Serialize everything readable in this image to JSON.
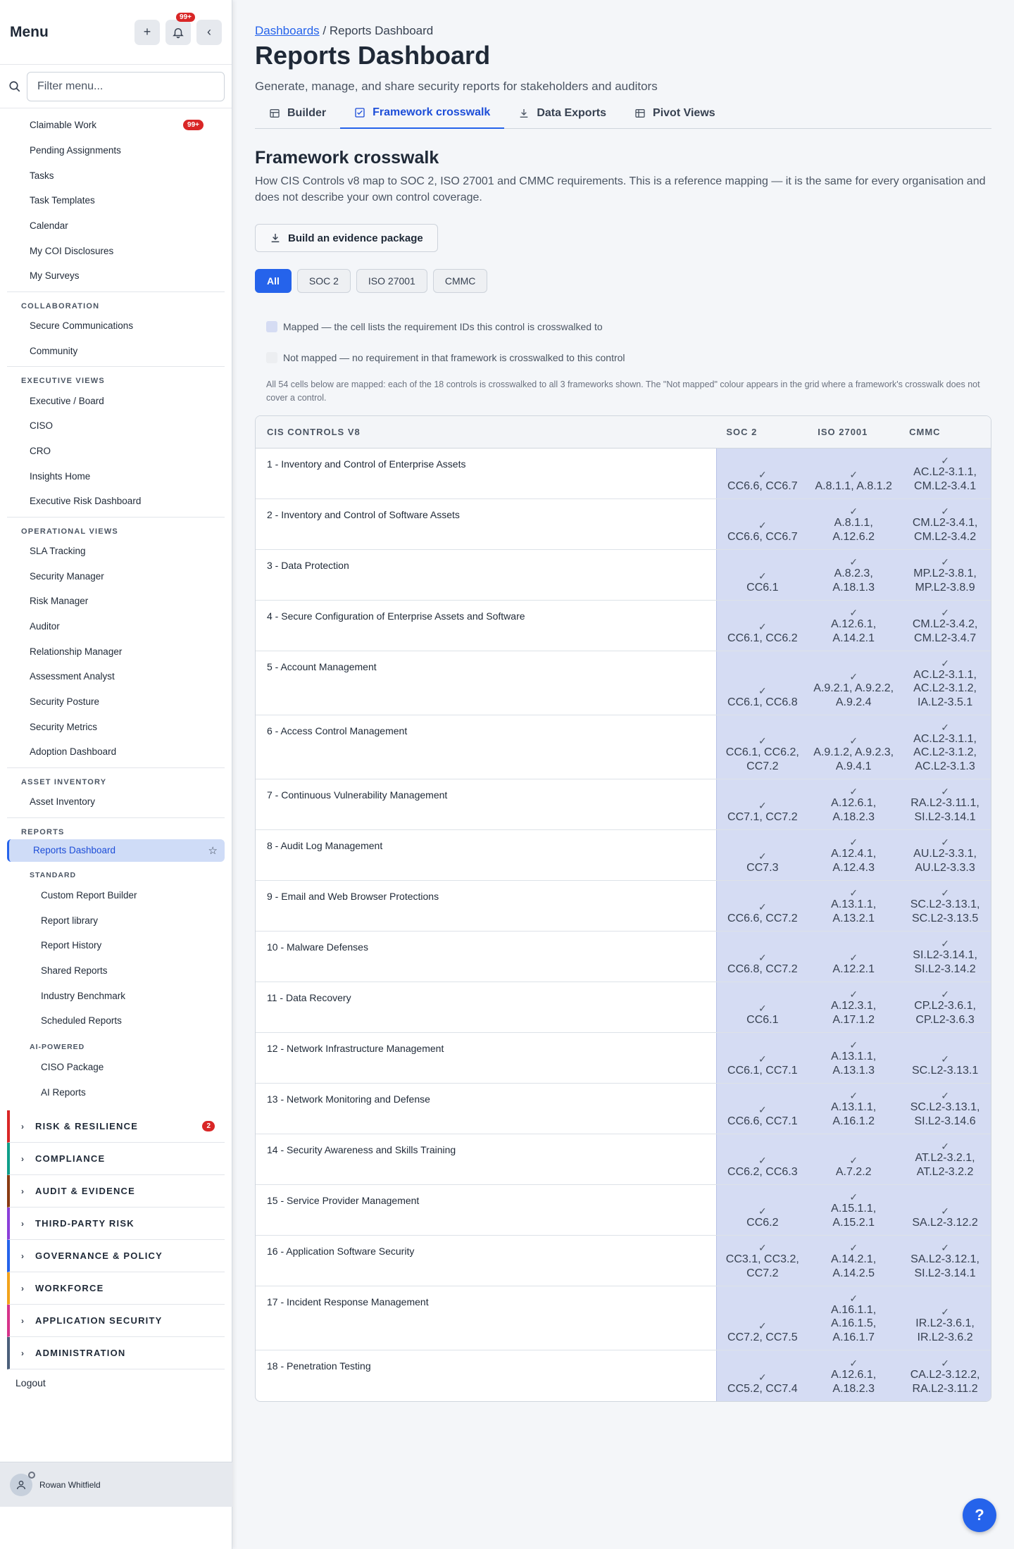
{
  "sidebar": {
    "title": "Menu",
    "notification_count": "99+",
    "filter_placeholder": "Filter menu...",
    "top_items": [
      {
        "label": "Claimable Work",
        "badge": "99+"
      },
      {
        "label": "Pending Assignments"
      },
      {
        "label": "Tasks"
      },
      {
        "label": "Task Templates"
      },
      {
        "label": "Calendar"
      },
      {
        "label": "My COI Disclosures"
      },
      {
        "label": "My Surveys"
      }
    ],
    "collaboration": {
      "heading": "COLLABORATION",
      "items": [
        "Secure Communications",
        "Community"
      ]
    },
    "executive": {
      "heading": "EXECUTIVE VIEWS",
      "items": [
        "Executive / Board",
        "CISO",
        "CRO",
        "Insights Home",
        "Executive Risk Dashboard"
      ]
    },
    "operational": {
      "heading": "OPERATIONAL VIEWS",
      "items": [
        "SLA Tracking",
        "Security Manager",
        "Risk Manager",
        "Auditor",
        "Relationship Manager",
        "Assessment Analyst",
        "Security Posture",
        "Security Metrics",
        "Adoption Dashboard"
      ]
    },
    "asset": {
      "heading": "ASSET INVENTORY",
      "items": [
        "Asset Inventory"
      ]
    },
    "reports": {
      "heading": "REPORTS",
      "active_item": "Reports Dashboard",
      "standard_heading": "STANDARD",
      "standard_items": [
        "Custom Report Builder",
        "Report library",
        "Report History",
        "Shared Reports",
        "Industry Benchmark",
        "Scheduled Reports"
      ],
      "ai_heading": "AI-POWERED",
      "ai_items": [
        "CISO Package",
        "AI Reports"
      ]
    },
    "categories": [
      {
        "label": "RISK & RESILIENCE",
        "color": "#d92626",
        "badge": "2"
      },
      {
        "label": "COMPLIANCE",
        "color": "#0f9f8a"
      },
      {
        "label": "AUDIT & EVIDENCE",
        "color": "#8a3b12"
      },
      {
        "label": "THIRD-PARTY RISK",
        "color": "#8b3fd9"
      },
      {
        "label": "GOVERNANCE & POLICY",
        "color": "#2563eb"
      },
      {
        "label": "WORKFORCE",
        "color": "#f2a31b"
      },
      {
        "label": "APPLICATION SECURITY",
        "color": "#d6338a"
      },
      {
        "label": "ADMINISTRATION",
        "color": "#4b5f7a"
      }
    ],
    "logout": "Logout",
    "user_name": "Rowan Whitfield"
  },
  "breadcrumb": {
    "parent": "Dashboards",
    "separator": " / ",
    "current": "Reports Dashboard"
  },
  "page": {
    "title": "Reports Dashboard",
    "subtitle": "Generate, manage, and share security reports for stakeholders and auditors"
  },
  "tabs": [
    {
      "label": "Builder",
      "icon": "table-icon"
    },
    {
      "label": "Framework crosswalk",
      "icon": "checklist-icon",
      "active": true
    },
    {
      "label": "Data Exports",
      "icon": "download-icon"
    },
    {
      "label": "Pivot Views",
      "icon": "grid-icon"
    }
  ],
  "crosswalk": {
    "title": "Framework crosswalk",
    "description": "How CIS Controls v8 map to SOC 2, ISO 27001 and CMMC requirements. This is a reference mapping — it is the same for every organisation and does not describe your own control coverage.",
    "evidence_button": "Build an evidence package",
    "filters": [
      "All",
      "SOC 2",
      "ISO 27001",
      "CMMC"
    ],
    "legend_mapped": "Mapped — the cell lists the requirement IDs this control is crosswalked to",
    "legend_not_mapped": "Not mapped — no requirement in that framework is crosswalked to this control",
    "mapped_color": "#d5dcf3",
    "not_mapped_color": "#eceef1",
    "note": "All 54 cells below are mapped: each of the 18 controls is crosswalked to all 3 frameworks shown. The \"Not mapped\" colour appears in the grid where a framework's crosswalk does not cover a control.",
    "columns": [
      "CIS CONTROLS V8",
      "SOC 2",
      "ISO 27001",
      "CMMC"
    ],
    "check": "✓",
    "rows": [
      {
        "control": "1 - Inventory and Control of Enterprise Assets",
        "soc2": "CC6.6, CC6.7",
        "iso": "A.8.1.1, A.8.1.2",
        "cmmc": "AC.L2-3.1.1, CM.L2-3.4.1"
      },
      {
        "control": "2 - Inventory and Control of Software Assets",
        "soc2": "CC6.6, CC6.7",
        "iso": "A.8.1.1, A.12.6.2",
        "cmmc": "CM.L2-3.4.1, CM.L2-3.4.2"
      },
      {
        "control": "3 - Data Protection",
        "soc2": "CC6.1",
        "iso": "A.8.2.3, A.18.1.3",
        "cmmc": "MP.L2-3.8.1, MP.L2-3.8.9"
      },
      {
        "control": "4 - Secure Configuration of Enterprise Assets and Software",
        "soc2": "CC6.1, CC6.2",
        "iso": "A.12.6.1, A.14.2.1",
        "cmmc": "CM.L2-3.4.2, CM.L2-3.4.7"
      },
      {
        "control": "5 - Account Management",
        "soc2": "CC6.1, CC6.8",
        "iso": "A.9.2.1, A.9.2.2, A.9.2.4",
        "cmmc": "AC.L2-3.1.1, AC.L2-3.1.2, IA.L2-3.5.1"
      },
      {
        "control": "6 - Access Control Management",
        "soc2": "CC6.1, CC6.2, CC7.2",
        "iso": "A.9.1.2, A.9.2.3, A.9.4.1",
        "cmmc": "AC.L2-3.1.1, AC.L2-3.1.2, AC.L2-3.1.3"
      },
      {
        "control": "7 - Continuous Vulnerability Management",
        "soc2": "CC7.1, CC7.2",
        "iso": "A.12.6.1, A.18.2.3",
        "cmmc": "RA.L2-3.11.1, SI.L2-3.14.1"
      },
      {
        "control": "8 - Audit Log Management",
        "soc2": "CC7.3",
        "iso": "A.12.4.1, A.12.4.3",
        "cmmc": "AU.L2-3.3.1, AU.L2-3.3.3"
      },
      {
        "control": "9 - Email and Web Browser Protections",
        "soc2": "CC6.6, CC7.2",
        "iso": "A.13.1.1, A.13.2.1",
        "cmmc": "SC.L2-3.13.1, SC.L2-3.13.5"
      },
      {
        "control": "10 - Malware Defenses",
        "soc2": "CC6.8, CC7.2",
        "iso": "A.12.2.1",
        "cmmc": "SI.L2-3.14.1, SI.L2-3.14.2"
      },
      {
        "control": "11 - Data Recovery",
        "soc2": "CC6.1",
        "iso": "A.12.3.1, A.17.1.2",
        "cmmc": "CP.L2-3.6.1, CP.L2-3.6.3"
      },
      {
        "control": "12 - Network Infrastructure Management",
        "soc2": "CC6.1, CC7.1",
        "iso": "A.13.1.1, A.13.1.3",
        "cmmc": "SC.L2-3.13.1"
      },
      {
        "control": "13 - Network Monitoring and Defense",
        "soc2": "CC6.6, CC7.1",
        "iso": "A.13.1.1, A.16.1.2",
        "cmmc": "SC.L2-3.13.1, SI.L2-3.14.6"
      },
      {
        "control": "14 - Security Awareness and Skills Training",
        "soc2": "CC6.2, CC6.3",
        "iso": "A.7.2.2",
        "cmmc": "AT.L2-3.2.1, AT.L2-3.2.2"
      },
      {
        "control": "15 - Service Provider Management",
        "soc2": "CC6.2",
        "iso": "A.15.1.1, A.15.2.1",
        "cmmc": "SA.L2-3.12.2"
      },
      {
        "control": "16 - Application Software Security",
        "soc2": "CC3.1, CC3.2, CC7.2",
        "iso": "A.14.2.1, A.14.2.5",
        "cmmc": "SA.L2-3.12.1, SI.L2-3.14.1"
      },
      {
        "control": "17 - Incident Response Management",
        "soc2": "CC7.2, CC7.5",
        "iso": "A.16.1.1, A.16.1.5, A.16.1.7",
        "cmmc": "IR.L2-3.6.1, IR.L2-3.6.2"
      },
      {
        "control": "18 - Penetration Testing",
        "soc2": "CC5.2, CC7.4",
        "iso": "A.12.6.1, A.18.2.3",
        "cmmc": "CA.L2-3.12.2, RA.L2-3.11.2"
      }
    ]
  }
}
